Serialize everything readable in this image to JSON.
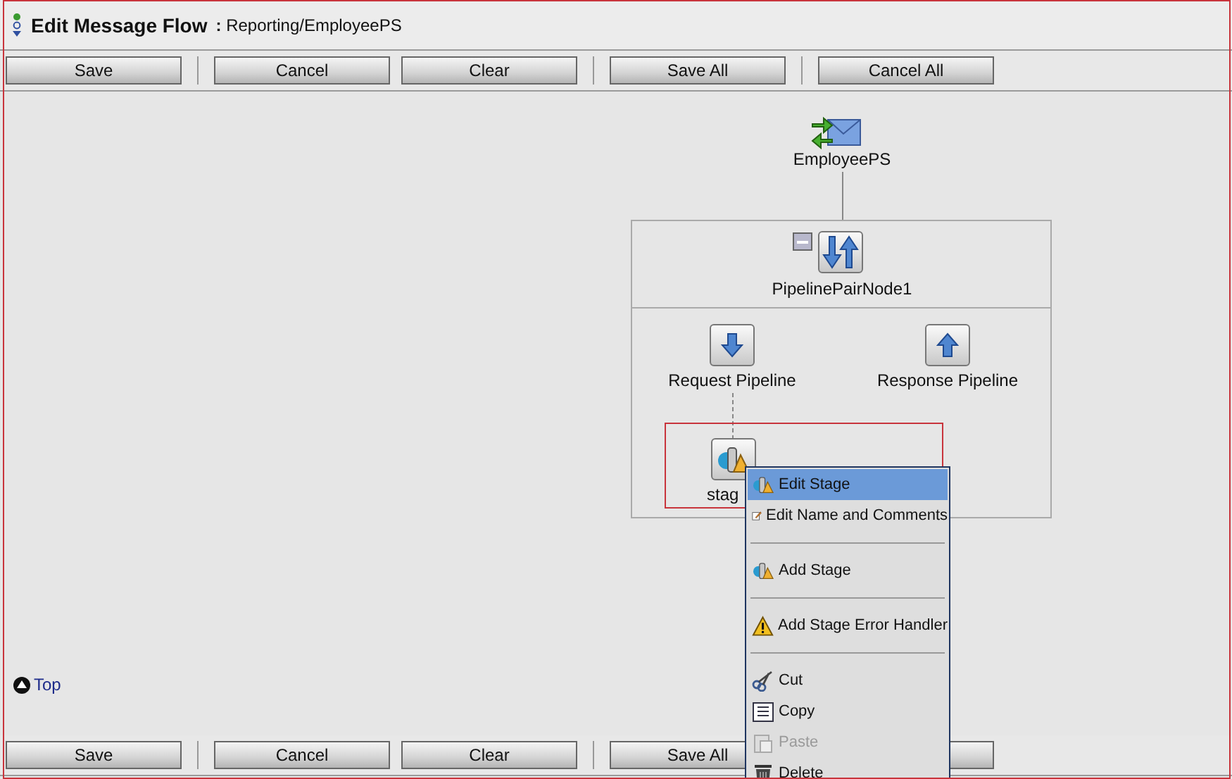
{
  "header": {
    "title": "Edit Message Flow",
    "separator": ":",
    "path": "Reporting/EmployeePS"
  },
  "top_toolbar": [
    {
      "kind": "button",
      "label": "Save"
    },
    {
      "kind": "button",
      "label": "Cancel"
    },
    {
      "kind": "button",
      "label": "Clear"
    },
    {
      "kind": "button",
      "label": "Save All"
    },
    {
      "kind": "button",
      "label": "Cancel All"
    }
  ],
  "flow": {
    "service": {
      "label": "EmployeePS"
    },
    "pipeline_pair": {
      "label": "PipelinePairNode1",
      "expanded": true
    },
    "request": {
      "label": "Request Pipeline"
    },
    "response": {
      "label": "Response Pipeline"
    },
    "stage": {
      "label": "stag",
      "selected": true
    }
  },
  "top_link": "Top",
  "bottom_toolbar": [
    {
      "kind": "button",
      "label": "Save"
    },
    {
      "kind": "button",
      "label": "Cancel"
    },
    {
      "kind": "button",
      "label": "Clear"
    },
    {
      "kind": "button",
      "label": "Save All"
    },
    {
      "kind": "covered"
    }
  ],
  "context_menu": [
    {
      "kind": "item",
      "label": "Edit Stage",
      "selected": true,
      "disabled": false
    },
    {
      "kind": "item",
      "label": "Edit Name and Comments",
      "selected": false,
      "disabled": false
    },
    {
      "kind": "separator"
    },
    {
      "kind": "item",
      "label": "Add Stage",
      "selected": false,
      "disabled": false
    },
    {
      "kind": "separator"
    },
    {
      "kind": "item",
      "label": "Add Stage Error Handler",
      "selected": false,
      "disabled": false
    },
    {
      "kind": "separator"
    },
    {
      "kind": "item",
      "label": "Cut",
      "selected": false,
      "disabled": false
    },
    {
      "kind": "item",
      "label": "Copy",
      "selected": false,
      "disabled": false
    },
    {
      "kind": "item",
      "label": "Paste",
      "selected": false,
      "disabled": true
    },
    {
      "kind": "item",
      "label": "Delete",
      "selected": false,
      "disabled": false
    }
  ]
}
